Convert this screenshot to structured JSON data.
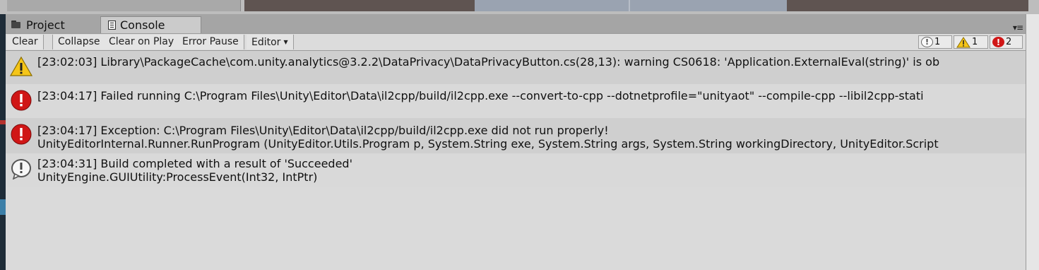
{
  "tabs": {
    "project_label": "Project",
    "console_label": "Console"
  },
  "toolbar": {
    "clear_label": "Clear",
    "collapse_label": "Collapse",
    "clear_on_play_label": "Clear on Play",
    "error_pause_label": "Error Pause",
    "editor_label": "Editor",
    "info_count": "1",
    "warning_count": "1",
    "error_count": "2"
  },
  "logs": [
    {
      "type": "warning",
      "icon": "warning-icon",
      "line1": "[23:02:03] Library\\PackageCache\\com.unity.analytics@3.2.2\\DataPrivacy\\DataPrivacyButton.cs(28,13): warning CS0618: 'Application.ExternalEval(string)' is ob",
      "line2": ""
    },
    {
      "type": "error",
      "icon": "error-icon",
      "line1": "[23:04:17] Failed running C:\\Program Files\\Unity\\Editor\\Data\\il2cpp/build/il2cpp.exe --convert-to-cpp --dotnetprofile=\"unityaot\" --compile-cpp --libil2cpp-stati",
      "line2": ""
    },
    {
      "type": "error",
      "icon": "error-icon",
      "line1": "[23:04:17] Exception: C:\\Program Files\\Unity\\Editor\\Data\\il2cpp/build/il2cpp.exe did not run properly!",
      "line2": "UnityEditorInternal.Runner.RunProgram (UnityEditor.Utils.Program p, System.String exe, System.String args, System.String workingDirectory, UnityEditor.Script"
    },
    {
      "type": "info",
      "icon": "info-icon",
      "line1": "[23:04:31] Build completed with a result of 'Succeeded'",
      "line2": "UnityEngine.GUIUtility:ProcessEvent(Int32, IntPtr)"
    }
  ],
  "colors": {
    "error_red": "#d01616",
    "warning_yellow": "#f5c518",
    "row_dark": "#cfcfcf",
    "row_light": "#d9d9d9"
  }
}
